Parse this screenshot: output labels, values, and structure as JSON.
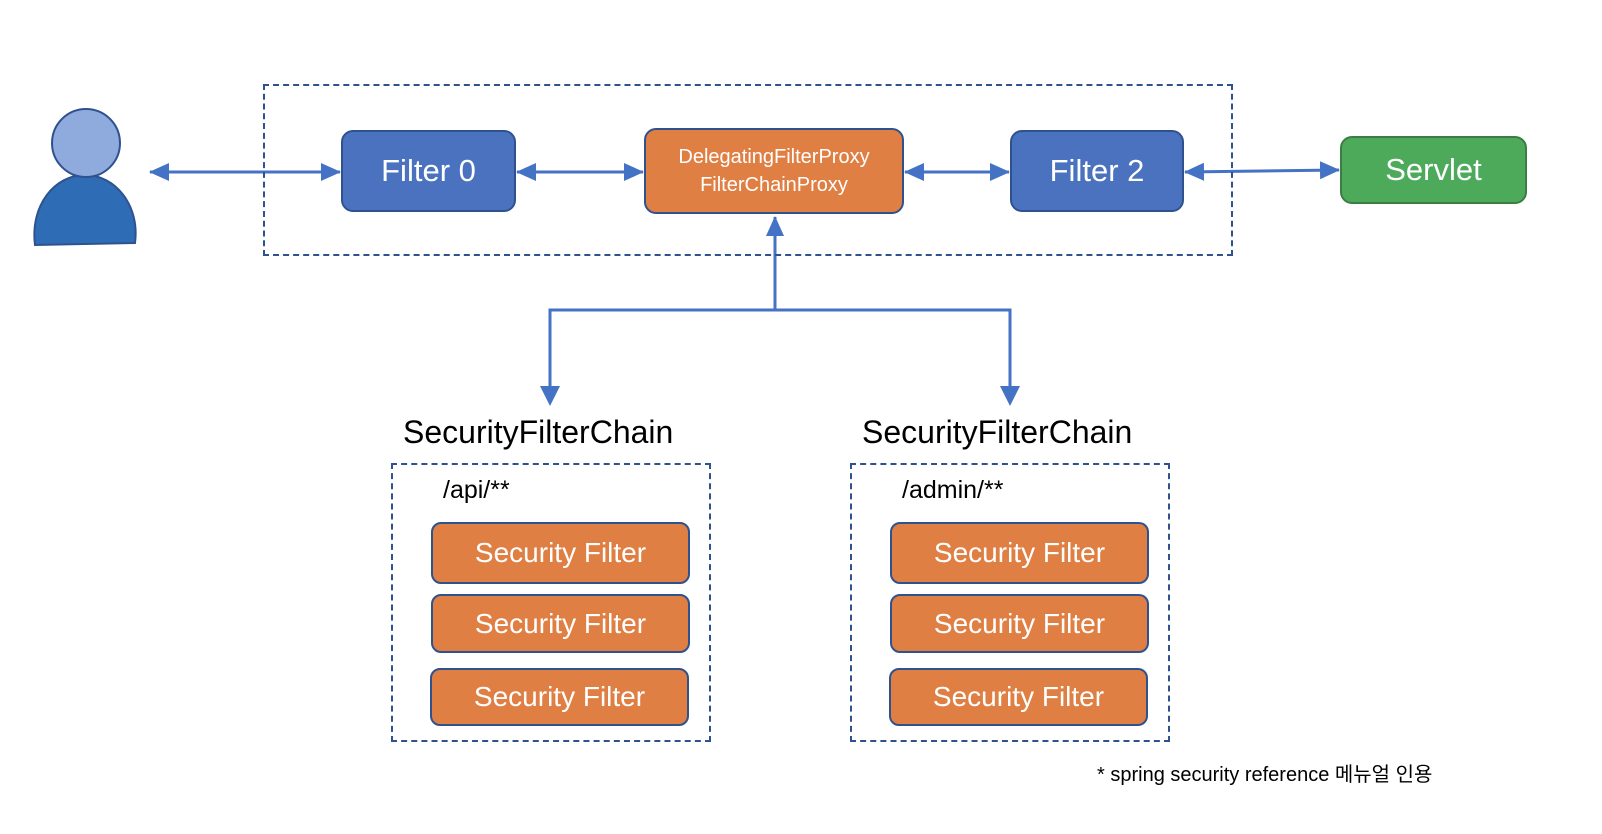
{
  "diagram": {
    "user": {
      "icon": "user-icon"
    },
    "servlet_container": {
      "filters": [
        {
          "id": "filter0",
          "label": "Filter 0"
        },
        {
          "id": "proxy",
          "lines": [
            "DelegatingFilterProxy",
            "FilterChainProxy"
          ]
        },
        {
          "id": "filter2",
          "label": "Filter 2"
        }
      ]
    },
    "servlet": {
      "label": "Servlet"
    },
    "security_filter_chains": [
      {
        "title": "SecurityFilterChain",
        "pattern": "/api/**",
        "filters": [
          "Security Filter",
          "Security Filter",
          "Security Filter"
        ]
      },
      {
        "title": "SecurityFilterChain",
        "pattern": "/admin/**",
        "filters": [
          "Security Filter",
          "Security Filter",
          "Security Filter"
        ]
      }
    ],
    "footnote": "* spring security reference 메뉴얼 인용",
    "colors": {
      "filter_blue": "#4a72bf",
      "proxy_orange": "#e07f43",
      "servlet_green": "#4caa5a",
      "border_navy": "#2f528f",
      "arrow_blue": "#4472c4",
      "user_head": "#8faadc",
      "user_body": "#2e6db5"
    }
  }
}
